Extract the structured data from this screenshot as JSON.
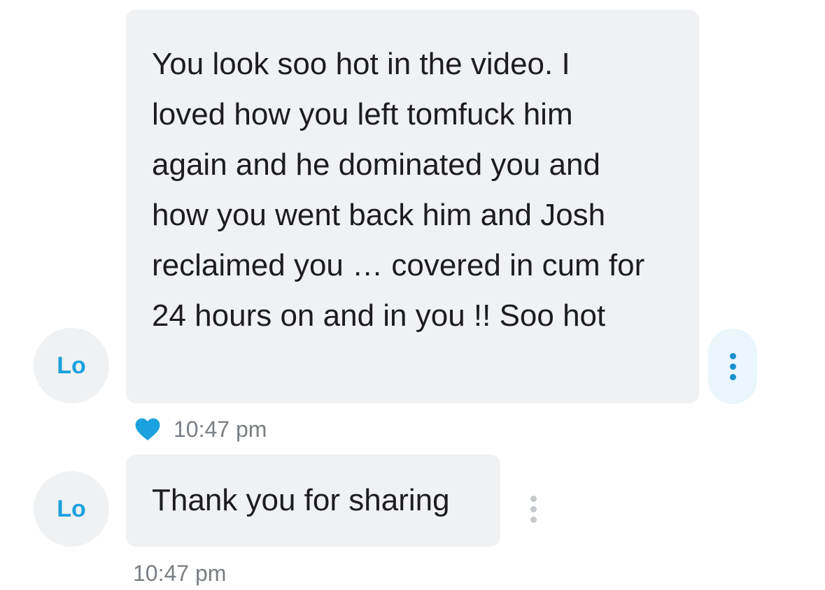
{
  "messages": [
    {
      "avatar_initials": "Lo",
      "text": "You look soo hot in the video. I loved how you left tomfuck him again and he dominated you and how you went back him and Josh reclaimed you … covered in cum for 24 hours on and in you !! Soo hot",
      "time": "10:47 pm",
      "liked": true,
      "heart_color": "#1aa1de"
    },
    {
      "avatar_initials": "Lo",
      "text": "Thank you for sharing",
      "time": "10:47 pm",
      "liked": false
    }
  ],
  "colors": {
    "bubble": "#f0f1f3",
    "accent": "#1aa1de",
    "timestamp": "#7a7f85"
  },
  "icons": {
    "more": "more-vertical-icon",
    "like": "heart-icon"
  }
}
